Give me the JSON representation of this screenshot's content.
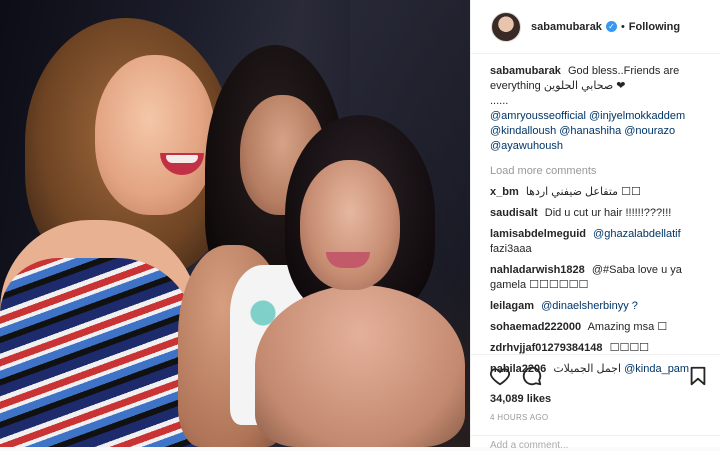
{
  "header": {
    "username": "sabamubarak",
    "verified_symbol": "✓",
    "separator": "•",
    "follow_label": "Following"
  },
  "caption": {
    "username": "sabamubarak",
    "lines": [
      "God bless..Friends are",
      "everything صحابي الحلوين ❤",
      "......",
      "@amryousseofficial @injyelmokkaddem",
      "@kindalloush @hanashiha @nourazo",
      "@ayawuhoush"
    ]
  },
  "load_more_label": "Load more comments",
  "comments": [
    {
      "user": "x_bm",
      "text": "متفاعل ضيفني اردها ☐☐"
    },
    {
      "user": "saudisalt",
      "text": "Did u cut ur hair !!!!!!???!!!"
    },
    {
      "user": "lamisabdelmeguid",
      "text": "@ghazalabdellatif",
      "text2": "fazi3aaa"
    },
    {
      "user": "nahladarwish1828",
      "text": "@#Saba love u ya",
      "text2": "gamela ☐☐☐☐☐☐"
    },
    {
      "user": "leilagam",
      "text": "@dinaelsherbinyy ?"
    },
    {
      "user": "sohaemad222000",
      "text": "Amazing msa ☐"
    },
    {
      "user": "zdrhvjjaf01279384148",
      "text": "☐☐☐☐"
    },
    {
      "user": "nabila2206",
      "text": "اجمل الجميلات",
      "text2": "@kinda_pam"
    }
  ],
  "icons": [
    "heart-icon",
    "comment-icon",
    "bookmark-icon"
  ],
  "likes_label": "34,089 likes",
  "time_label": "4 HOURS AGO",
  "add_comment_placeholder": "Add a comment..."
}
